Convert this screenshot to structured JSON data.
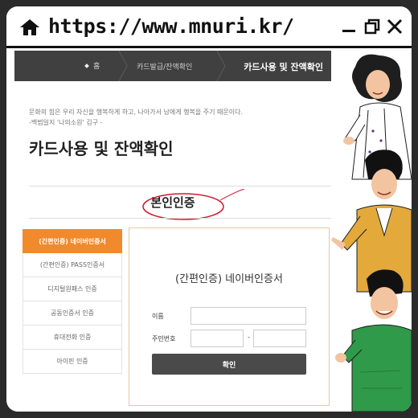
{
  "browser": {
    "url": "https://www.mnuri.kr/",
    "icons": [
      "home-icon",
      "minimize-icon",
      "restore-icon",
      "close-icon"
    ]
  },
  "nav": {
    "home": "홈",
    "middle": "카드발급/잔액확인",
    "current": "카드사용 및 잔액확인"
  },
  "quote": {
    "line1": "문화의 힘은 우리 자신을 행복하게 하고, 나아가서 남에게 행복을 주기 때문이다.",
    "line2": "-백범일지 '나의소원' 김구 -"
  },
  "page_title": "카드사용 및 잔액확인",
  "auth_title": "본인인증",
  "menu": [
    {
      "label": "(간편인증) 네이버인증서",
      "active": true
    },
    {
      "label": "(간편인증) PASS인증서",
      "active": false
    },
    {
      "label": "디지털원패스 인증",
      "active": false
    },
    {
      "label": "공동인증서 인증",
      "active": false
    },
    {
      "label": "휴대전화 인증",
      "active": false
    },
    {
      "label": "아이핀 인증",
      "active": false
    }
  ],
  "form": {
    "title": "(간편인증) 네이버인증서",
    "name_label": "이름",
    "rrn_label": "주민번호",
    "dash": "-",
    "submit": "확인"
  },
  "colors": {
    "accent": "#f08a2c",
    "navbar": "#404040",
    "annotation": "#d01a2a"
  }
}
